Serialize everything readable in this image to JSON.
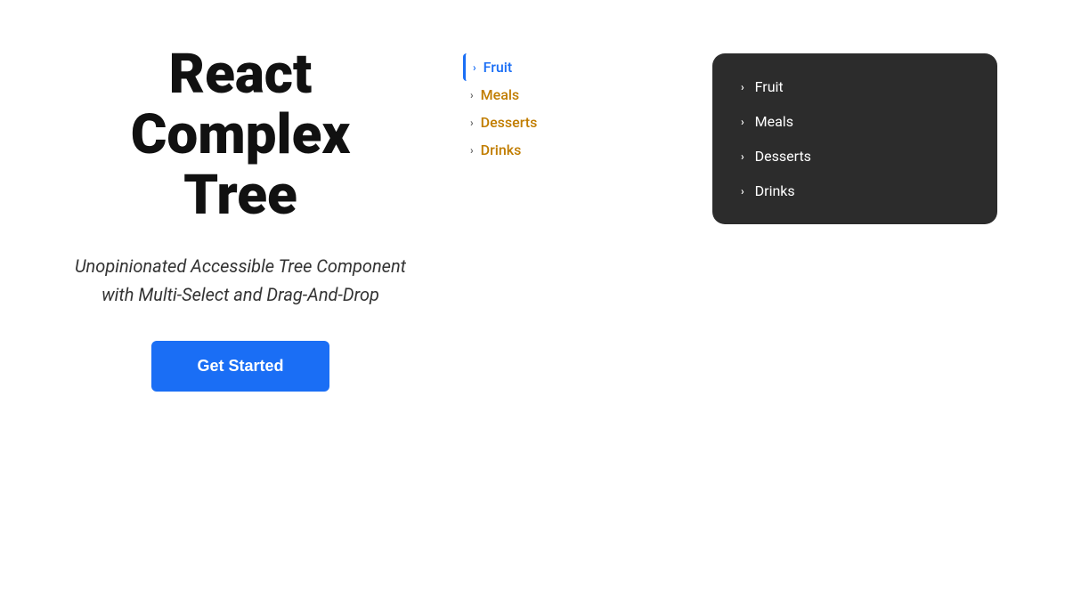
{
  "hero": {
    "title_line1": "React",
    "title_line2": "Complex",
    "title_line3": "Tree",
    "subtitle": "Unopinionated Accessible Tree Component with Multi-Select and Drag-And-Drop",
    "cta_label": "Get Started"
  },
  "light_tree": {
    "items": [
      {
        "label": "Fruit",
        "color": "blue",
        "active": true
      },
      {
        "label": "Meals",
        "color": "gold",
        "active": false
      },
      {
        "label": "Desserts",
        "color": "gold",
        "active": false
      },
      {
        "label": "Drinks",
        "color": "gold",
        "active": false
      }
    ]
  },
  "dark_tree": {
    "items": [
      {
        "label": "Fruit"
      },
      {
        "label": "Meals"
      },
      {
        "label": "Desserts"
      },
      {
        "label": "Drinks"
      }
    ]
  },
  "icons": {
    "chevron_right": "›"
  }
}
